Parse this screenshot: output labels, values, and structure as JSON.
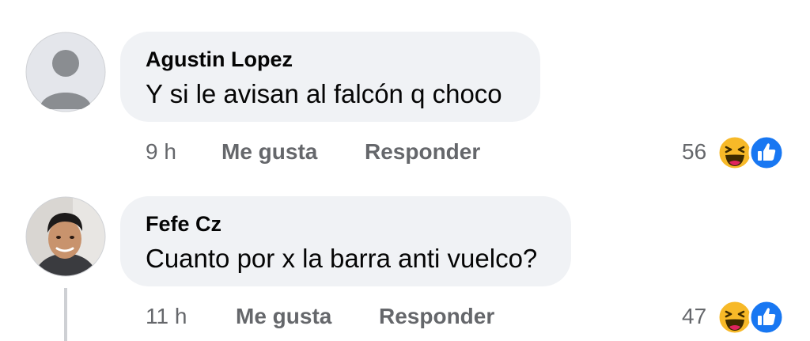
{
  "comments": [
    {
      "author": "Agustin Lopez",
      "text": "Y si le avisan al falcón q choco",
      "time": "9 h",
      "like_label": "Me gusta",
      "reply_label": "Responder",
      "reaction_count": "56",
      "avatar": "default-avatar-icon",
      "reactions": [
        "haha-icon",
        "like-icon"
      ]
    },
    {
      "author": "Fefe Cz",
      "text": "Cuanto por x la barra anti vuelco?",
      "time": "11 h",
      "like_label": "Me gusta",
      "reply_label": "Responder",
      "reaction_count": "47",
      "avatar": "profile-photo",
      "reactions": [
        "haha-icon",
        "like-icon"
      ]
    }
  ],
  "colors": {
    "bubble": "#f0f2f5",
    "secondary_text": "#65676b",
    "like_blue": "#1877f2",
    "haha_yellow": "#f7b928",
    "avatar_gray": "#8a8d91"
  }
}
